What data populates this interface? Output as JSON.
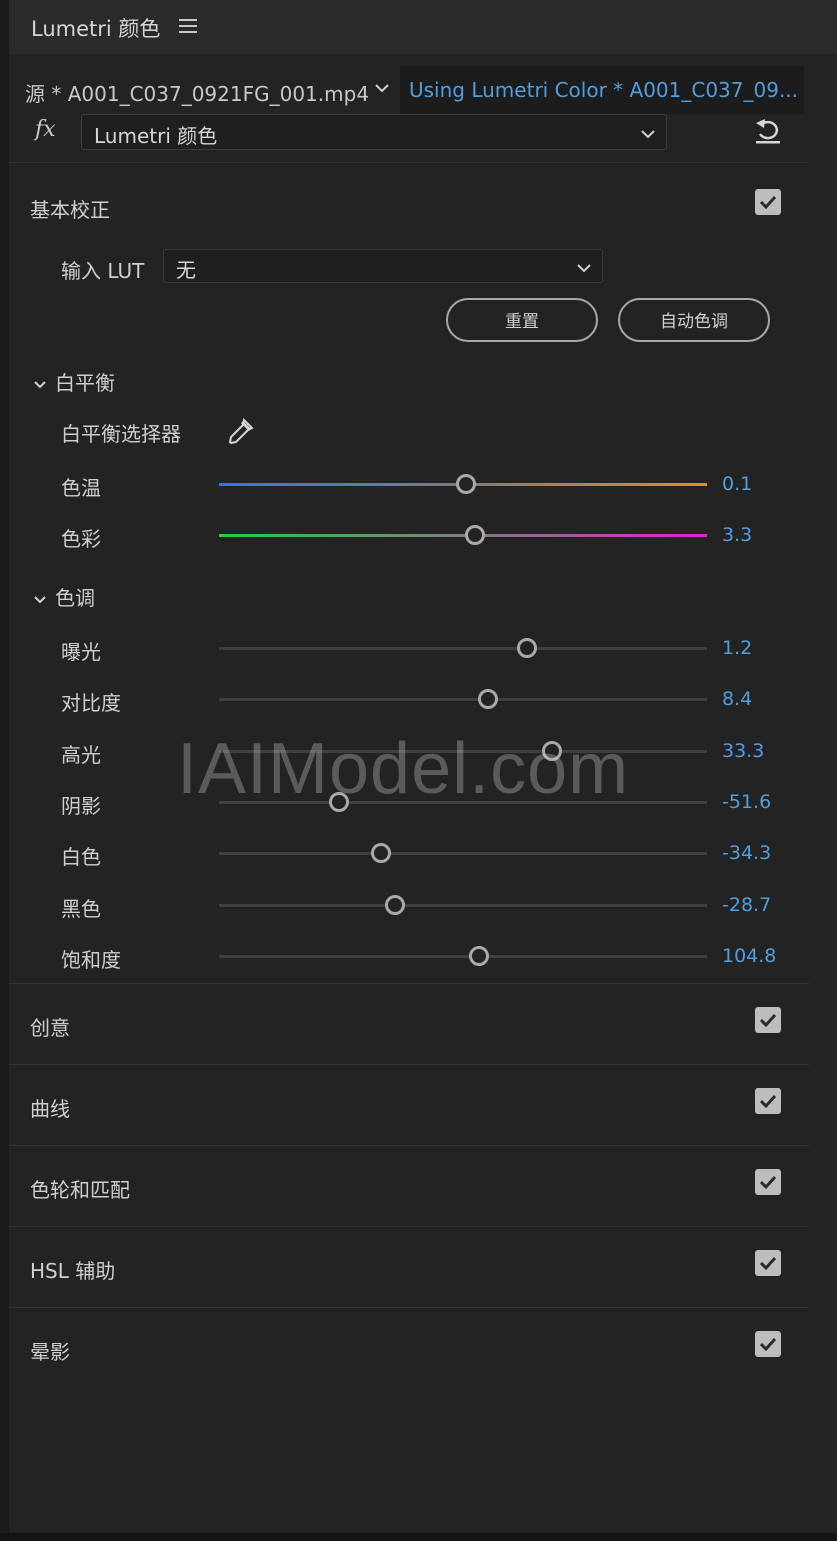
{
  "panel": {
    "title": "Lumetri 颜色"
  },
  "source": {
    "label": "源 * A001_C037_0921FG_001.mp4",
    "clip_label": "Using Lumetri Color * A001_C037_09..."
  },
  "effect": {
    "fx_symbol": "fx",
    "selected": "Lumetri 颜色"
  },
  "basic_correction": {
    "title": "基本校正",
    "lut_label": "输入 LUT",
    "lut_value": "无",
    "reset_label": "重置",
    "auto_label": "自动色调",
    "white_balance": {
      "title": "白平衡",
      "picker_label": "白平衡选择器",
      "sliders": [
        {
          "label": "色温",
          "value": "0.1",
          "position": 0.507
        },
        {
          "label": "色彩",
          "value": "3.3",
          "position": 0.524
        }
      ]
    },
    "tone": {
      "title": "色调",
      "sliders": [
        {
          "label": "曝光",
          "value": "1.2",
          "position": 0.632
        },
        {
          "label": "对比度",
          "value": "8.4",
          "position": 0.552
        },
        {
          "label": "高光",
          "value": "33.3",
          "position": 0.682
        },
        {
          "label": "阴影",
          "value": "-51.6",
          "position": 0.245
        },
        {
          "label": "白色",
          "value": "-34.3",
          "position": 0.331
        },
        {
          "label": "黑色",
          "value": "-28.7",
          "position": 0.36
        },
        {
          "label": "饱和度",
          "value": "104.8",
          "position": 0.533
        }
      ]
    }
  },
  "sections": [
    {
      "title": "创意",
      "enabled": true
    },
    {
      "title": "曲线",
      "enabled": true
    },
    {
      "title": "色轮和匹配",
      "enabled": true
    },
    {
      "title": "HSL 辅助",
      "enabled": true
    },
    {
      "title": "晕影",
      "enabled": true
    }
  ],
  "watermark": "IAIModel.com",
  "colors": {
    "accent_blue": "#4f9ee0",
    "temp_cool": "#2f78e0",
    "temp_warm": "#e88a2a",
    "tint_green": "#22d040",
    "tint_magenta": "#e020d8"
  }
}
